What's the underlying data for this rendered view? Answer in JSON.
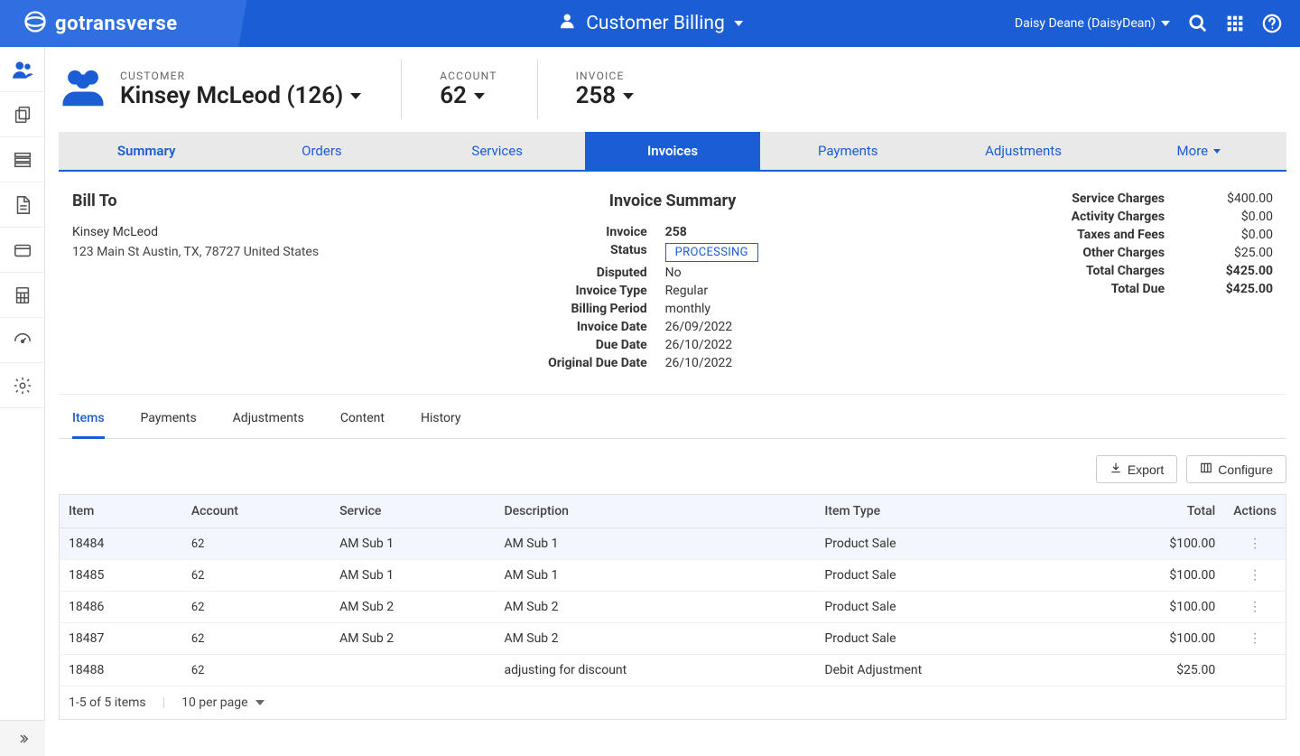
{
  "topbar": {
    "brand": "gotransverse",
    "center_label": "Customer Billing",
    "user_display": "Daisy Deane (DaisyDean)"
  },
  "breadcrumb": {
    "customer_label": "CUSTOMER",
    "customer_value": "Kinsey McLeod (126)",
    "account_label": "ACCOUNT",
    "account_value": "62",
    "invoice_label": "INVOICE",
    "invoice_value": "258"
  },
  "tabs_main": [
    "Summary",
    "Orders",
    "Services",
    "Invoices",
    "Payments",
    "Adjustments",
    "More"
  ],
  "tabs_main_active": 3,
  "billto": {
    "heading": "Bill To",
    "name": "Kinsey McLeod",
    "address": "123 Main St Austin, TX, 78727 United States"
  },
  "invoice_summary": {
    "heading": "Invoice Summary",
    "fields": [
      {
        "k": "Invoice",
        "v": "258"
      },
      {
        "k": "Status",
        "v": "PROCESSING",
        "chip": true
      },
      {
        "k": "Disputed",
        "v": "No"
      },
      {
        "k": "Invoice Type",
        "v": "Regular"
      },
      {
        "k": "Billing Period",
        "v": "monthly"
      },
      {
        "k": "Invoice Date",
        "v": "26/09/2022"
      },
      {
        "k": "Due Date",
        "v": "26/10/2022"
      },
      {
        "k": "Original Due Date",
        "v": "26/10/2022"
      }
    ]
  },
  "totals": [
    {
      "k": "Service Charges",
      "v": "$400.00"
    },
    {
      "k": "Activity Charges",
      "v": "$0.00"
    },
    {
      "k": "Taxes and Fees",
      "v": "$0.00"
    },
    {
      "k": "Other Charges",
      "v": "$25.00"
    },
    {
      "k": "Total Charges",
      "v": "$425.00",
      "bold": true
    },
    {
      "k": "Total Due",
      "v": "$425.00",
      "bold": true
    }
  ],
  "subtabs": [
    "Items",
    "Payments",
    "Adjustments",
    "Content",
    "History"
  ],
  "subtabs_active": 0,
  "buttons": {
    "export": "Export",
    "configure": "Configure"
  },
  "items_table": {
    "headers": [
      "Item",
      "Account",
      "Service",
      "Description",
      "Item Type",
      "Total",
      "Actions"
    ],
    "rows": [
      {
        "item": "18484",
        "account": "62",
        "service": "AM Sub 1",
        "description": "AM Sub 1",
        "type": "Product Sale",
        "total": "$100.00",
        "actions": true,
        "hl": true
      },
      {
        "item": "18485",
        "account": "62",
        "service": "AM Sub 1",
        "description": "AM Sub 1",
        "type": "Product Sale",
        "total": "$100.00",
        "actions": true
      },
      {
        "item": "18486",
        "account": "62",
        "service": "AM Sub 2",
        "description": "AM Sub 2",
        "type": "Product Sale",
        "total": "$100.00",
        "actions": true
      },
      {
        "item": "18487",
        "account": "62",
        "service": "AM Sub 2",
        "description": "AM Sub 2",
        "type": "Product Sale",
        "total": "$100.00",
        "actions": true
      },
      {
        "item": "18488",
        "account": "62",
        "service": "",
        "description": "adjusting for discount",
        "type": "Debit Adjustment",
        "total": "$25.00",
        "actions": false
      }
    ],
    "footer_count": "1-5 of 5 items",
    "per_page": "10 per page"
  }
}
